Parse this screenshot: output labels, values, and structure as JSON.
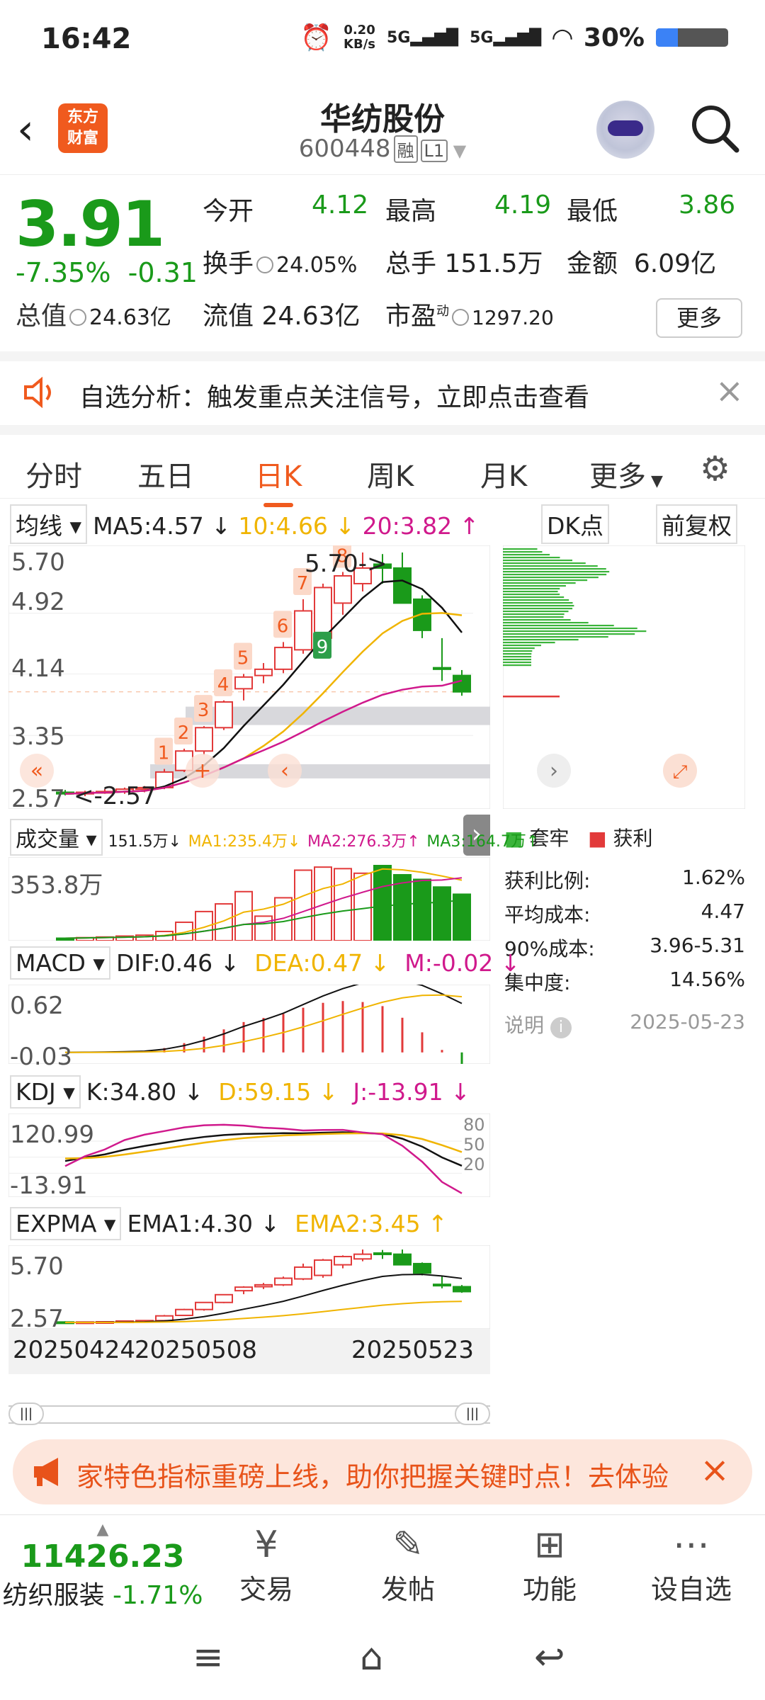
{
  "status": {
    "time": "16:42",
    "net_speed": "0.20\nKB/s",
    "net_top": "0.20",
    "net_bottom": "KB/s",
    "sig1": "5G",
    "sig2": "5G",
    "battery": "30%"
  },
  "header": {
    "title": "华纺股份",
    "code": "600448",
    "tag1": "融",
    "tag2": "L1",
    "logo_line1": "东方",
    "logo_line2": "财富"
  },
  "quote": {
    "price": "3.91",
    "pct": "-7.35%",
    "chg": "-0.31",
    "open_label": "今开",
    "open": "4.12",
    "high_label": "最高",
    "high": "4.19",
    "low_label": "最低",
    "low": "3.86",
    "turnover_label": "换手",
    "turnover": "24.05%",
    "volume_label": "总手",
    "volume": "151.5万",
    "amount_label": "金额",
    "amount": "6.09亿",
    "mcap_label": "总值",
    "mcap": "24.63亿",
    "float_label": "流值",
    "float": "24.63亿",
    "pe_label": "市盈",
    "pe_sup": "动",
    "pe": "1297.20",
    "more": "更多"
  },
  "alert": {
    "text": "自选分析：触发重点关注信号，立即点击查看"
  },
  "tabs": [
    "分时",
    "五日",
    "日K",
    "周K",
    "月K",
    "更多"
  ],
  "ma": {
    "selector": "均线",
    "ma5": "MA5:4.57 ↓",
    "ma10": "10:4.66 ↓",
    "ma20": "20:3.82 ↑",
    "dk": "DK点",
    "fq": "前复权"
  },
  "kchart": {
    "y_top": "5.70",
    "y2": "4.92",
    "y3": "4.14",
    "y4": "3.35",
    "y_bottom": "2.57",
    "max_label": "5.70->",
    "min_label": "<-2.57",
    "signals": [
      "1",
      "2",
      "3",
      "4",
      "5",
      "6",
      "7",
      "8",
      "9"
    ]
  },
  "vol": {
    "selector": "成交量",
    "v": "151.5万↓",
    "ma1": "MA1:235.4万↓",
    "ma2": "MA2:276.3万↑",
    "ma3": "MA3:164.7万↑",
    "y": "353.8万"
  },
  "macd": {
    "selector": "MACD",
    "dif": "DIF:0.46 ↓",
    "dea": "DEA:0.47 ↓",
    "m": "M:-0.02 ↓",
    "y_top": "0.62",
    "y_bottom": "-0.03"
  },
  "kdj": {
    "selector": "KDJ",
    "k": "K:34.80 ↓",
    "d": "D:59.15 ↓",
    "j": "J:-13.91 ↓",
    "y_top": "120.99",
    "y_bottom": "-13.91",
    "l80": "80",
    "l50": "50",
    "l20": "20"
  },
  "expma": {
    "selector": "EXPMA",
    "e1": "EMA1:4.30 ↓",
    "e2": "EMA2:3.45 ↑",
    "y_top": "5.70",
    "y_bottom": "2.57"
  },
  "dates": [
    "20250424",
    "20250508",
    "20250523"
  ],
  "chip": {
    "legend_trapped": "套牢",
    "legend_profit": "获利",
    "rows": [
      {
        "label": "获利比例:",
        "value": "1.62%"
      },
      {
        "label": "平均成本:",
        "value": "4.47"
      },
      {
        "label": "90%成本:",
        "value": "3.96-5.31"
      },
      {
        "label": "集中度:",
        "value": "14.56%"
      }
    ],
    "note": "说明",
    "date": "2025-05-23"
  },
  "banner": {
    "text": "家特色指标重磅上线，助你把握关键时点！去体验"
  },
  "bottom": {
    "index_value": "11426.23",
    "index_name": "纺织服装",
    "index_pct": "-1.71%",
    "items": [
      "交易",
      "发帖",
      "功能",
      "设自选"
    ]
  },
  "colors": {
    "up": "#e23a3a",
    "down": "#1a9a1a",
    "accent": "#f05a1e",
    "ma5": "#111111",
    "ma10": "#f0b400",
    "ma20": "#d0198c"
  },
  "chart_data": {
    "type": "candlestick",
    "dates_shown": [
      "20250424",
      "20250508",
      "20250523"
    ],
    "ohlc": [
      [
        2.62,
        2.65,
        2.58,
        2.6
      ],
      [
        2.6,
        2.64,
        2.57,
        2.62
      ],
      [
        2.62,
        2.66,
        2.6,
        2.63
      ],
      [
        2.63,
        2.68,
        2.6,
        2.66
      ],
      [
        2.66,
        2.7,
        2.62,
        2.68
      ],
      [
        2.68,
        2.92,
        2.66,
        2.88
      ],
      [
        2.9,
        3.18,
        2.88,
        3.15
      ],
      [
        3.15,
        3.47,
        3.1,
        3.45
      ],
      [
        3.45,
        3.8,
        3.42,
        3.78
      ],
      [
        3.95,
        4.14,
        3.8,
        4.1
      ],
      [
        4.12,
        4.28,
        4.02,
        4.2
      ],
      [
        4.2,
        4.55,
        4.15,
        4.48
      ],
      [
        4.45,
        5.1,
        4.4,
        4.95
      ],
      [
        4.6,
        5.3,
        4.5,
        5.25
      ],
      [
        5.05,
        5.45,
        4.9,
        5.4
      ],
      [
        5.3,
        5.7,
        5.2,
        5.5
      ],
      [
        5.55,
        5.68,
        5.3,
        5.5
      ],
      [
        5.5,
        5.7,
        5.05,
        5.05
      ],
      [
        5.1,
        5.15,
        4.6,
        4.7
      ],
      [
        4.22,
        4.6,
        4.05,
        4.2
      ],
      [
        4.12,
        4.19,
        3.86,
        3.91
      ]
    ],
    "volume_wan": [
      8,
      10,
      12,
      15,
      18,
      30,
      60,
      95,
      120,
      160,
      80,
      140,
      230,
      240,
      235,
      220,
      245,
      215,
      200,
      175,
      151.5
    ],
    "y_range": [
      2.57,
      5.7
    ]
  }
}
